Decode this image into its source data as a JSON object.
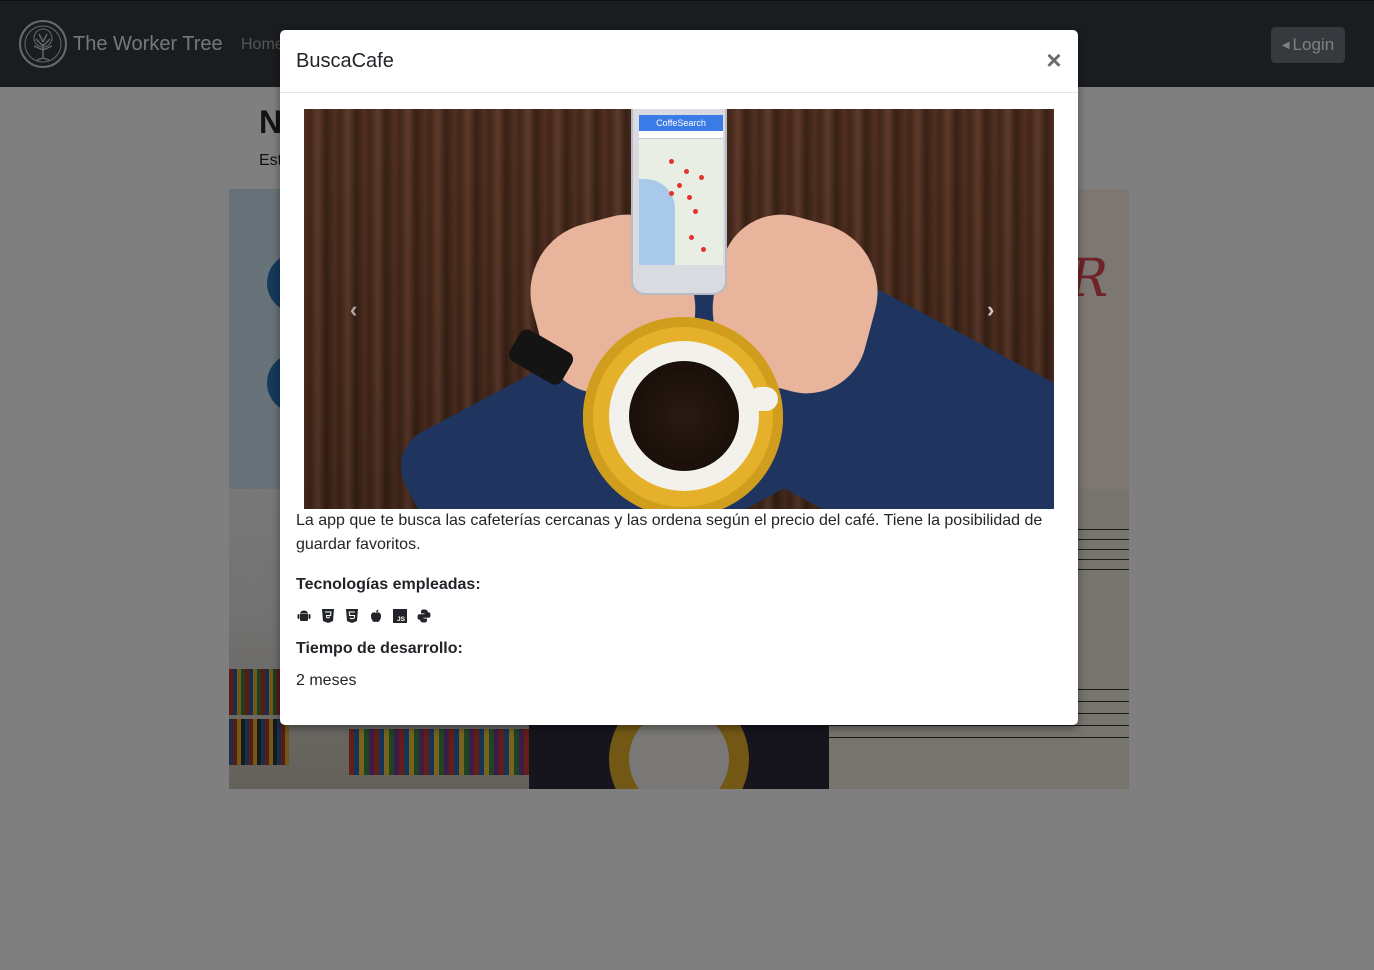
{
  "navbar": {
    "brand": "The Worker Tree",
    "home_label": "Home",
    "login_label": "Login"
  },
  "page": {
    "title_partial": "N",
    "subtitle_partial": "Est"
  },
  "modal": {
    "title": "BuscaCafe",
    "close_symbol": "×",
    "carousel": {
      "phone_app_title": "CoffeSearch",
      "prev_symbol": "‹",
      "next_symbol": "›"
    },
    "description": "La app que te busca las cafeterías cercanas y las ordena según el precio del café. Tiene la posibilidad de guardar favoritos.",
    "tech_label": "Tecnologías empleadas:",
    "tech_icons": [
      "android-icon",
      "css3-icon",
      "html5-icon",
      "apple-icon",
      "js-icon",
      "python-icon"
    ],
    "time_label": "Tiempo de desarrollo:",
    "time_value": "2 meses"
  }
}
